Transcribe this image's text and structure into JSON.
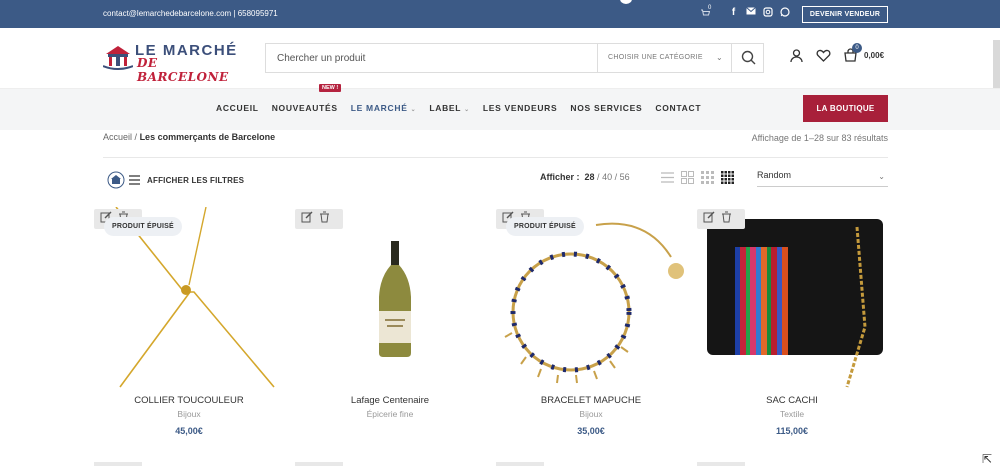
{
  "topbar": {
    "contact": "contact@lemarchedebarcelone.com | 658095971",
    "cart_count": "0",
    "social_icons": [
      "facebook-icon",
      "mail-icon",
      "instagram-icon",
      "whatsapp-icon"
    ],
    "vendor_button": "DEVENIR VENDEUR"
  },
  "logo": {
    "line1": "LE MARCHÉ",
    "line2": "DE BARCELONE"
  },
  "search": {
    "placeholder": "Chercher un produit",
    "category": "CHOISIR UNE CATÉGORIE"
  },
  "cart": {
    "count": "0",
    "total": "0,00€"
  },
  "nav": {
    "items": [
      "ACCUEIL",
      "NOUVEAUTÉS",
      "LE MARCHÉ",
      "LABEL",
      "LES VENDEURS",
      "NOS SERVICES",
      "CONTACT"
    ],
    "new_badge": "NEW !",
    "boutique": "LA BOUTIQUE"
  },
  "breadcrumb": {
    "home": "Accueil",
    "separator": "/",
    "current": "Les commerçants de Barcelone"
  },
  "results": "Affichage de 1–28 sur 83 résultats",
  "toolbar": {
    "filters_label": "AFFICHER LES FILTRES",
    "show_label": "Afficher :",
    "per_page": [
      "28",
      "40",
      "56"
    ],
    "sort": "Random"
  },
  "products": [
    {
      "name": "COLLIER TOUCOULEUR",
      "category": "Bijoux",
      "price": "45,00€",
      "badge": "PRODUIT ÉPUISÉ"
    },
    {
      "name": "Lafage Centenaire",
      "category": "Épicerie fine",
      "price": "",
      "badge": ""
    },
    {
      "name": "BRACELET MAPUCHE",
      "category": "Bijoux",
      "price": "35,00€",
      "badge": "PRODUIT ÉPUISÉ"
    },
    {
      "name": "SAC CACHI",
      "category": "Textile",
      "price": "115,00€",
      "badge": ""
    }
  ],
  "colors": {
    "primary": "#3c5a86",
    "accent": "#a8203a"
  }
}
